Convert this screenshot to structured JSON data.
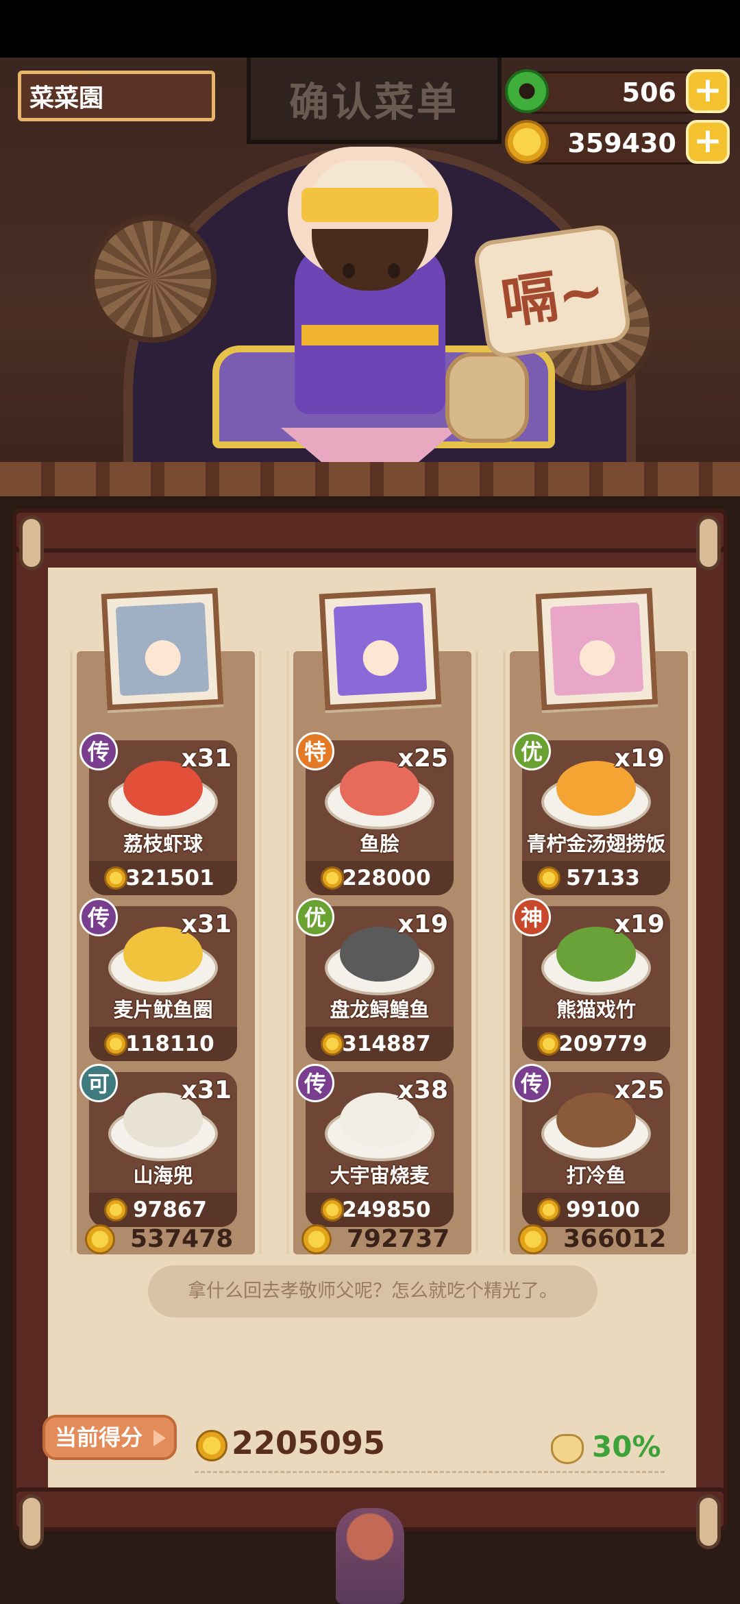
{
  "header": {
    "player_name": "菜菜園",
    "sign_title": "确认菜单",
    "jade": "506",
    "coins": "359430"
  },
  "scene": {
    "speech": "嗝~"
  },
  "columns": [
    {
      "total": "537478",
      "dishes": [
        {
          "grade": "传",
          "grade_color": "#7a3e8e",
          "name": "荔枝虾球",
          "count": "x31",
          "price": "321501",
          "food_color": "#e2503a"
        },
        {
          "grade": "传",
          "grade_color": "#7a3e8e",
          "name": "麦片鱿鱼圈",
          "count": "x31",
          "price": "118110",
          "food_color": "#f1c23c"
        },
        {
          "grade": "可",
          "grade_color": "#3f7a7e",
          "name": "山海兜",
          "count": "x31",
          "price": "97867",
          "food_color": "#e8e2d4"
        }
      ]
    },
    {
      "total": "792737",
      "dishes": [
        {
          "grade": "特",
          "grade_color": "#e27a26",
          "name": "鱼脍",
          "count": "x25",
          "price": "228000",
          "food_color": "#e86a5a"
        },
        {
          "grade": "优",
          "grade_color": "#6aa232",
          "name": "盘龙鲟鳇鱼",
          "count": "x19",
          "price": "314887",
          "food_color": "#5a5a5a"
        },
        {
          "grade": "传",
          "grade_color": "#7a3e8e",
          "name": "大宇宙烧麦",
          "count": "x38",
          "price": "249850",
          "food_color": "#f2eee6"
        }
      ]
    },
    {
      "total": "366012",
      "dishes": [
        {
          "grade": "优",
          "grade_color": "#6aa232",
          "name": "青柠金汤翅捞饭",
          "count": "x19",
          "price": "57133",
          "food_color": "#f3a432"
        },
        {
          "grade": "神",
          "grade_color": "#c8482a",
          "name": "熊猫戏竹",
          "count": "x19",
          "price": "209779",
          "food_color": "#6aa23a"
        },
        {
          "grade": "传",
          "grade_color": "#7a3e8e",
          "name": "打冷鱼",
          "count": "x25",
          "price": "99100",
          "food_color": "#8a5a3a"
        }
      ]
    }
  ],
  "dialogue": "拿什么回去孝敬师父呢？怎么就吃个精光了。",
  "footer": {
    "score_label": "当前得分",
    "score": "2205095",
    "bonus": "30%"
  },
  "colors": {
    "portrait_1": "#9fb0c4",
    "portrait_2": "#8a6ad8",
    "portrait_3": "#e8a6c8"
  }
}
